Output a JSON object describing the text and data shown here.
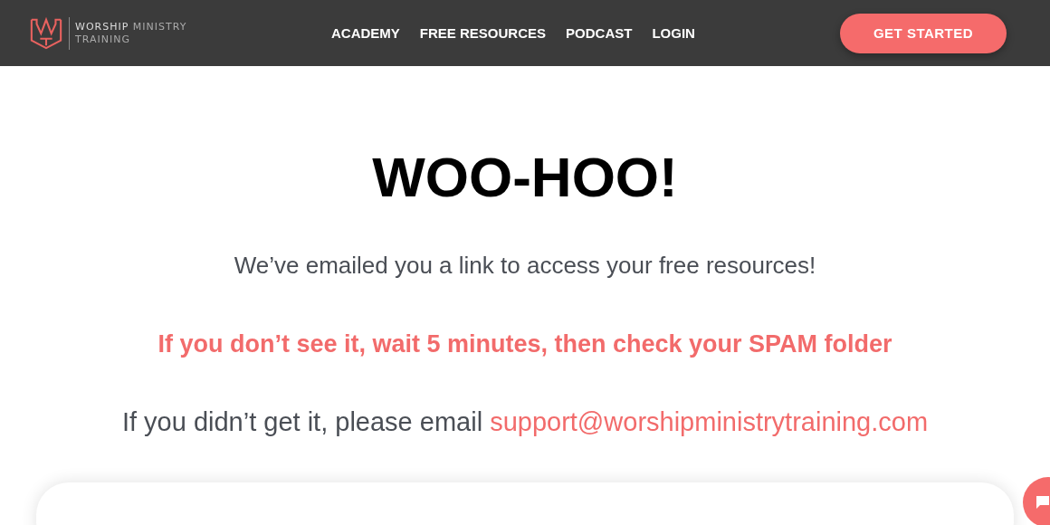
{
  "header": {
    "logo": {
      "line_1": "**WORSHIP** MINISTRY",
      "line_2": "TRAINING"
    },
    "nav": [
      {
        "label": "ACADEMY"
      },
      {
        "label": "FREE RESOURCES"
      },
      {
        "label": "PODCAST"
      },
      {
        "label": "LOGIN"
      }
    ],
    "cta": "GET STARTED"
  },
  "main": {
    "heading": "WOO-HOO!",
    "message": "We’ve emailed you a link to access your free resources!",
    "warning": "If you don’t see it, wait 5 minutes, then check your SPAM folder",
    "support_text": "If you didn’t get it, please email",
    "support_email": "support@worshipministrytraining.com"
  }
}
